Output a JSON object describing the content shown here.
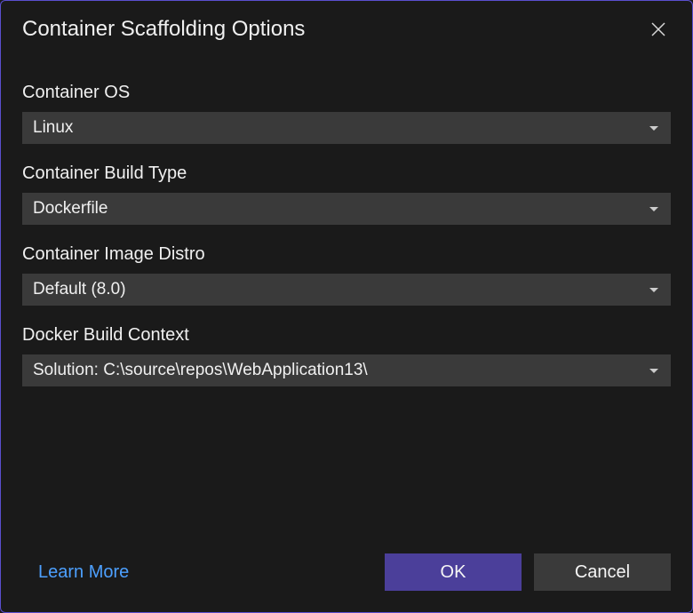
{
  "dialog": {
    "title": "Container Scaffolding Options"
  },
  "fields": {
    "container_os": {
      "label": "Container OS",
      "value": "Linux"
    },
    "build_type": {
      "label": "Container Build Type",
      "value": "Dockerfile"
    },
    "image_distro": {
      "label": "Container Image Distro",
      "value": "Default (8.0)"
    },
    "build_context": {
      "label": "Docker Build Context",
      "value": "Solution: C:\\source\\repos\\WebApplication13\\"
    }
  },
  "footer": {
    "learn_more": "Learn More",
    "ok": "OK",
    "cancel": "Cancel"
  }
}
